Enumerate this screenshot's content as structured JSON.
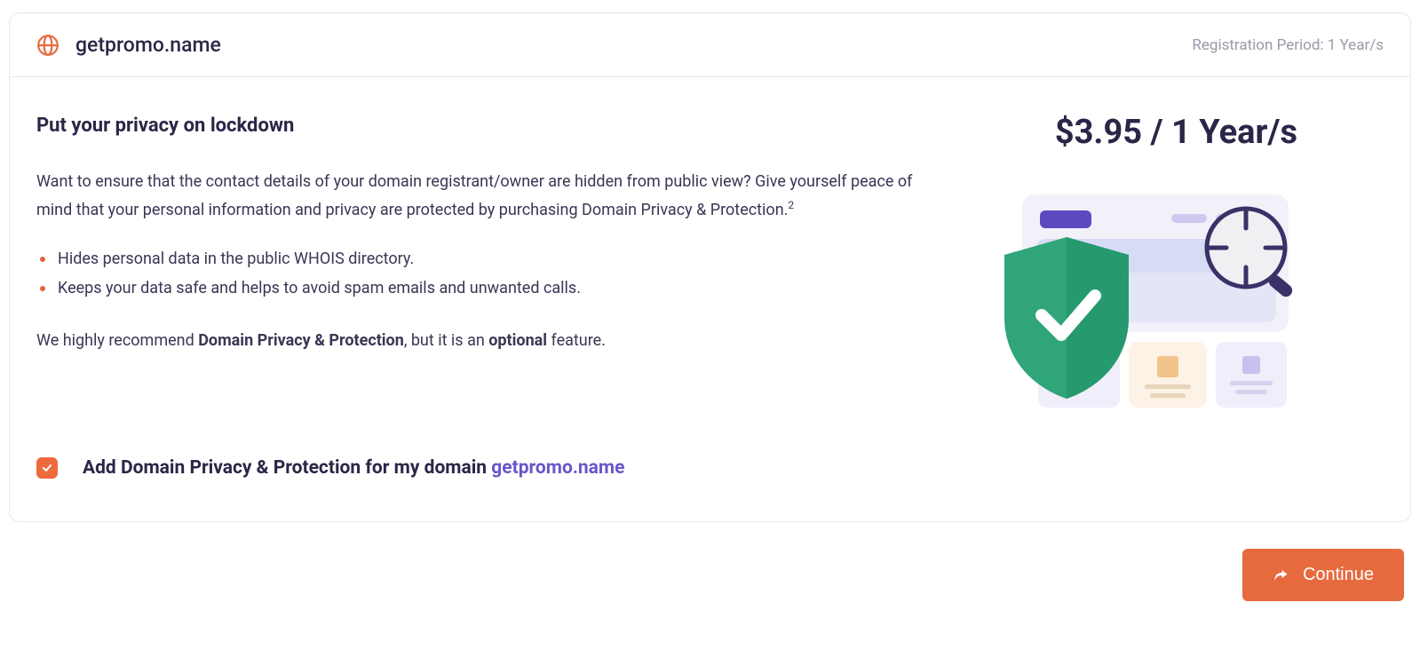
{
  "header": {
    "domain": "getpromo.name",
    "reg_period_label": "Registration Period: 1 Year/s"
  },
  "section": {
    "title": "Put your privacy on lockdown",
    "intro_a": "Want to ensure that the contact details of your domain registrant/owner are hidden from public view? Give yourself peace of mind that your personal information and privacy are protected by purchasing Domain Privacy & Protection.",
    "intro_sup": "2",
    "features": [
      "Hides personal data in the public WHOIS directory.",
      "Keeps your data safe and helps to avoid spam emails and unwanted calls."
    ],
    "reco_pre": "We highly recommend ",
    "reco_bold1": "Domain Privacy & Protection",
    "reco_mid": ", but it is an ",
    "reco_bold2": "optional",
    "reco_post": " feature."
  },
  "price": {
    "display": "$3.95 / 1 Year/s"
  },
  "option": {
    "checked": true,
    "label_pre": "Add Domain Privacy & Protection for my domain ",
    "label_domain": "getpromo.name"
  },
  "actions": {
    "continue_label": "Continue"
  },
  "colors": {
    "accent_orange": "#e66a3e",
    "accent_purple": "#6a56c8",
    "shield_green": "#2fa579"
  }
}
